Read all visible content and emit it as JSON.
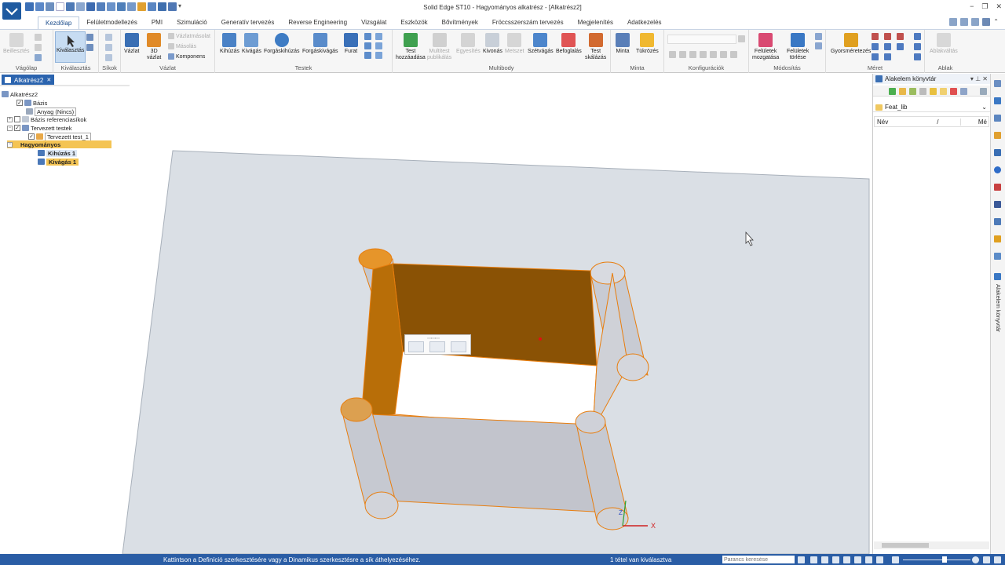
{
  "window": {
    "title": "Solid Edge ST10 - Hagyományos alkatrész - [Alkatrész2]",
    "controls": [
      "−",
      "❐",
      "✕"
    ]
  },
  "tabs": [
    "Kezdőlap",
    "Felületmodellezés",
    "PMI",
    "Szimuláció",
    "Generatív tervezés",
    "Reverse Engineering",
    "Vizsgálat",
    "Eszközök",
    "Bővítmények",
    "Fröccsszerszám tervezés",
    "Megjelenítés",
    "Adatkezelés"
  ],
  "ribbon": {
    "groups": {
      "vagolap": "Vágólap",
      "kivalasztas": "Kiválasztás",
      "sikok": "Síkok",
      "vazlat": "Vázlat",
      "testek": "Testek",
      "multibody": "Multibody",
      "minta": "Minta",
      "konfiguraciok": "Konfigurációk",
      "modositas": "Módosítás",
      "meret": "Méret",
      "ablak": "Ablak"
    },
    "buttons": {
      "beillesztes": "Beillesztés",
      "kivalasztas": "Kiválasztás",
      "vazlat": "Vázlat",
      "vazlat3d_1": "3D",
      "vazlat3d_2": "vázlat",
      "vazlatmasolat": "Vázlatmásolat",
      "masolas": "Másolás",
      "komponens": "Komponens",
      "kihuzas": "Kihúzás",
      "kivagas": "Kivágás",
      "forgaskihuzas": "Forgáskihúzás",
      "forgaskivagas": "Forgáskivágás",
      "furat": "Furat",
      "test_hozzaadasa_1": "Test",
      "test_hozzaadasa_2": "hozzáadása",
      "multitest_1": "Multitest",
      "multitest_2": "publikálás",
      "egyesites": "Egyesítés",
      "kivonas": "Kivonás",
      "metszet": "Metszet",
      "szetvagas": "Szétvágás",
      "befoglalas": "Befoglalás",
      "test_skalazas_1": "Test",
      "test_skalazas_2": "skálázás",
      "minta": "Minta",
      "tukrozes": "Tükrözés",
      "feluletek_mozgatasa_1": "Felületek",
      "feluletek_mozgatasa_2": "mozgatása",
      "feluletek_torlese_1": "Felületek",
      "feluletek_torlese_2": "törlése",
      "gyorsmeretezes": "Gyorsméretezés",
      "ablakvaltas": "Ablakváltás"
    }
  },
  "document_tab": {
    "label": "Alkatrész2",
    "close": "✕"
  },
  "tree": {
    "root": "Alkatrész2",
    "bazis": "Bázis",
    "anyag": "Anyag (Nincs)",
    "bazis_ref": "Bázis referenciasíkok",
    "tervezett_testek": "Tervezett testek",
    "tervezett_test_1": "Tervezett test_1",
    "hagyomanyos": "Hagyományos",
    "kihuzas_1": "Kihúzás 1",
    "kivagas_1": "Kivágás 1"
  },
  "right_panel": {
    "title": "Alakelem könyvtár",
    "folder": "Feat_lib",
    "col_nev": "Név",
    "col_sort": "/",
    "col_me": "Mé"
  },
  "sidebar": {
    "vertical_label": "Alakelem könyvtár"
  },
  "status": {
    "message": "Kattintson a Definíció szerkesztésére vagy a Dinamikus szerkesztésre a sík áthelyezéséhez.",
    "selection": "1 tétel van kiválasztva",
    "command_placeholder": "Parancs keresése"
  },
  "triad": {
    "x": "X",
    "z": "Z"
  },
  "colors": {
    "accent_blue": "#2a5da5",
    "selection_orange": "#e87d0d",
    "face_brown": "#8a5205",
    "model_gray": "#c4c8d0",
    "plane_gray": "#dadfe5"
  }
}
